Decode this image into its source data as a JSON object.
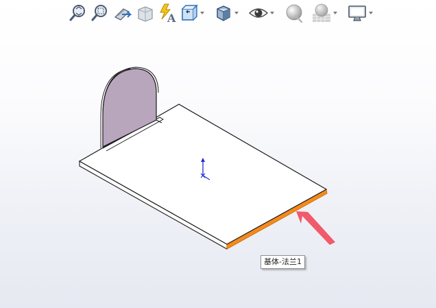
{
  "toolbar": {
    "buttons": [
      {
        "icon": "zoom-to-fit-icon",
        "has_dropdown": false
      },
      {
        "icon": "zoom-to-area-icon",
        "has_dropdown": false
      },
      {
        "icon": "previous-view-icon",
        "has_dropdown": false
      },
      {
        "icon": "section-view-icon",
        "has_dropdown": false
      },
      {
        "icon": "dynamic-annotation-view-icon",
        "has_dropdown": false
      },
      {
        "icon": "view-orientation-icon",
        "has_dropdown": true
      },
      {
        "icon": "display-style-icon",
        "has_dropdown": true
      },
      {
        "icon": "hide-show-items-icon",
        "has_dropdown": true
      },
      {
        "icon": "edit-appearance-icon",
        "has_dropdown": false
      },
      {
        "icon": "apply-scene-icon",
        "has_dropdown": true
      },
      {
        "icon": "view-settings-icon",
        "has_dropdown": true
      }
    ]
  },
  "model": {
    "plate_color": "#ffffff",
    "tab_color": "#b8a6bd",
    "highlight_edge_color": "#f28a1e",
    "arrow_color": "#f05a6a",
    "axis_y_color": "#1a2bd6",
    "axis_x_color": "#1a2bd6"
  },
  "tooltip": {
    "text": "基体-法兰1"
  }
}
